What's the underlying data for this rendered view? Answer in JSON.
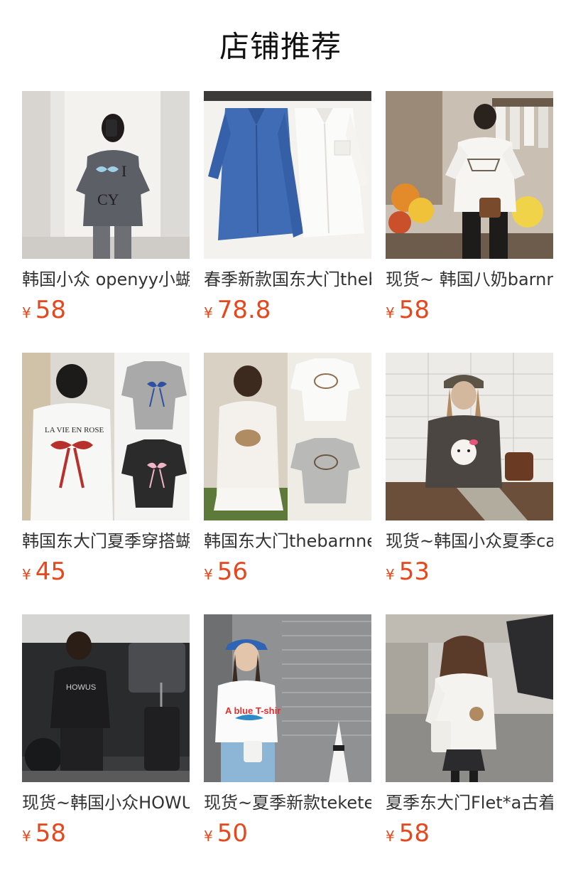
{
  "section": {
    "title": "店铺推荐"
  },
  "currency_symbol": "¥",
  "products": [
    {
      "name": "韩国小众 openyy小蝴蝶结",
      "price": "58",
      "image": "woman-selfie-mirror-tshirt"
    },
    {
      "name": "春季新款国东大门thebarnnet衬衫",
      "price": "78.8",
      "image": "blue-and-white-shirts-on-hangers"
    },
    {
      "name": "现货~ 韩国八奶barnnet印花T恤",
      "price": "58",
      "image": "woman-back-view-printed-tee"
    },
    {
      "name": "韩国东大门夏季穿搭蝴蝶结T恤",
      "price": "45",
      "image": "bow-print-tshirts"
    },
    {
      "name": "韩国东大门thebarnnet短袖",
      "price": "56",
      "image": "basket-print-tshirts"
    },
    {
      "name": "现货~韩国小众夏季cat印花T恤",
      "price": "53",
      "image": "woman-cap-kitty-tee"
    },
    {
      "name": "现货~韩国小众HOWUS短袖",
      "price": "58",
      "image": "woman-black-tee-luggage"
    },
    {
      "name": "现货~夏季新款teketeke印花T恤",
      "price": "50",
      "image": "woman-blue-cap-dolphin-tee"
    },
    {
      "name": "夏季东大门Flet*a古着T恤",
      "price": "58",
      "image": "woman-back-white-tee-street"
    }
  ]
}
